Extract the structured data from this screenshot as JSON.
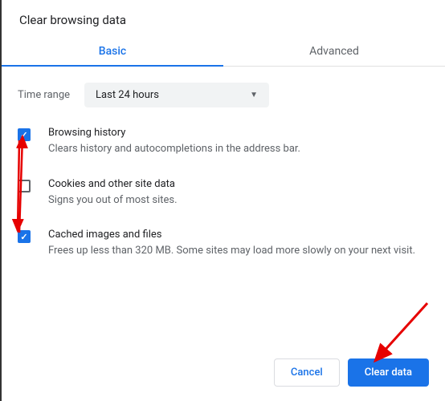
{
  "dialog": {
    "title": "Clear browsing data",
    "tabs": {
      "basic": "Basic",
      "advanced": "Advanced"
    },
    "time_range": {
      "label": "Time range",
      "value": "Last 24 hours"
    },
    "options": [
      {
        "checked": true,
        "title": "Browsing history",
        "desc": "Clears history and autocompletions in the address bar."
      },
      {
        "checked": false,
        "title": "Cookies and other site data",
        "desc": "Signs you out of most sites."
      },
      {
        "checked": true,
        "title": "Cached images and files",
        "desc": "Frees up less than 320 MB. Some sites may load more slowly on your next visit."
      }
    ],
    "buttons": {
      "cancel": "Cancel",
      "clear": "Clear data"
    }
  },
  "colors": {
    "accent": "#1a73e8",
    "arrow": "#e60000"
  }
}
